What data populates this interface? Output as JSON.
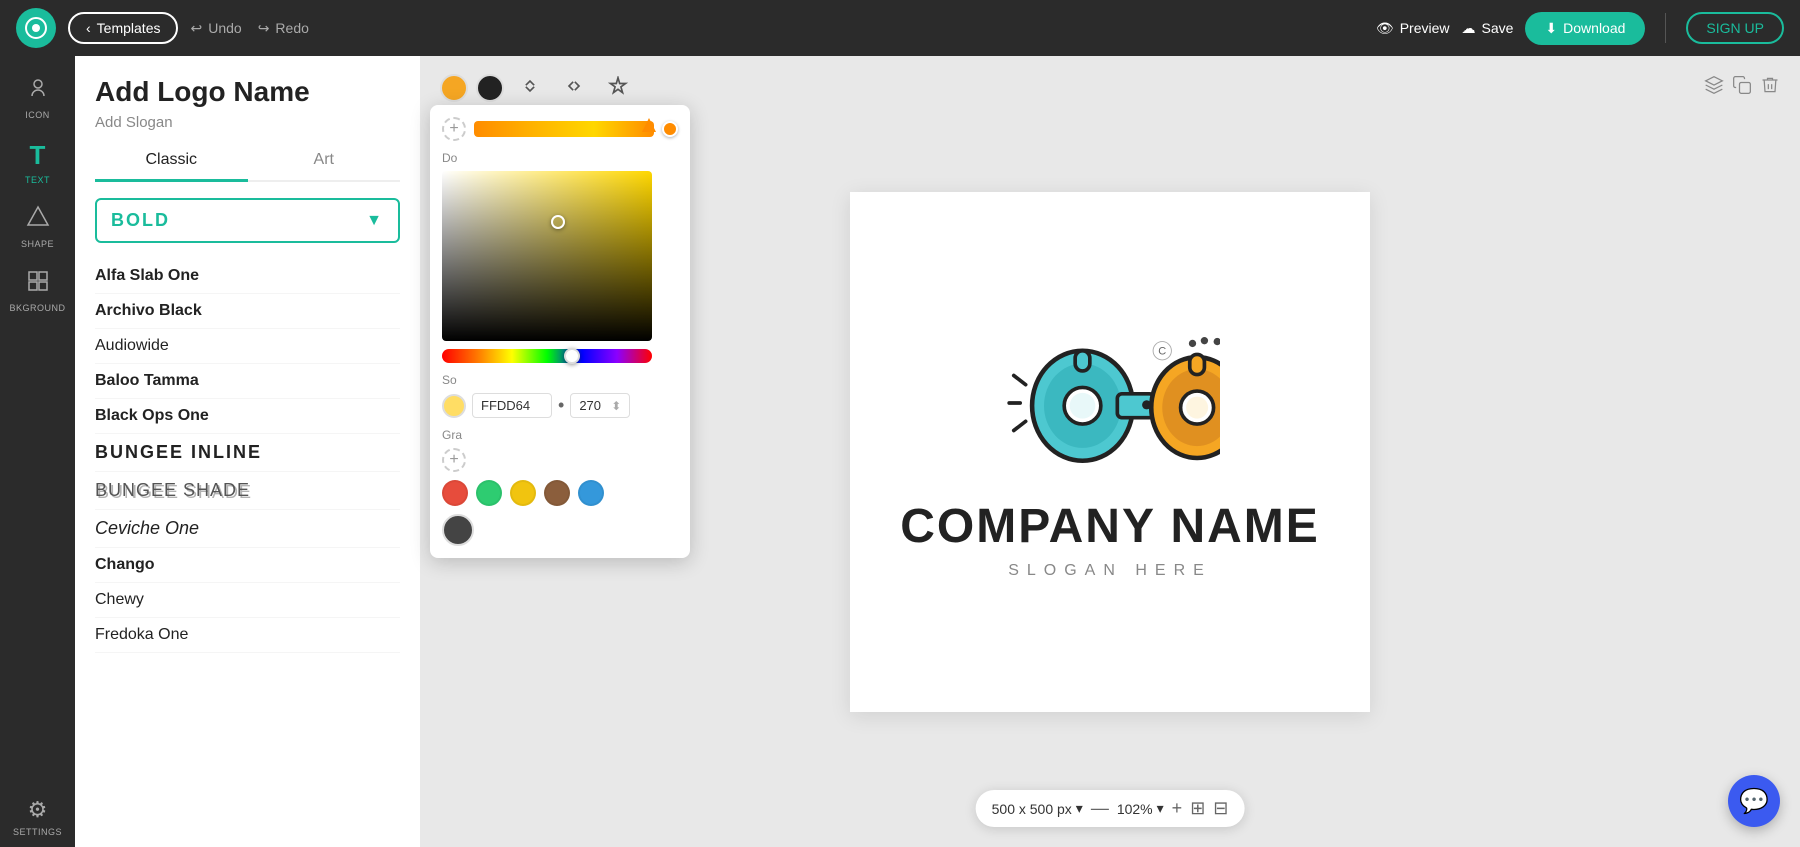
{
  "topbar": {
    "logo_symbol": "◎",
    "templates_label": "Templates",
    "undo_label": "Undo",
    "redo_label": "Redo",
    "preview_label": "Preview",
    "save_label": "Save",
    "download_label": "Download",
    "signup_label": "SIGN UP"
  },
  "sidebar": {
    "items": [
      {
        "id": "icon",
        "label": "ICON",
        "symbol": "⊙",
        "active": false
      },
      {
        "id": "text",
        "label": "TEXT",
        "symbol": "T",
        "active": true
      },
      {
        "id": "shape",
        "label": "SHAPE",
        "symbol": "⬡",
        "active": false
      },
      {
        "id": "bkground",
        "label": "BKGROUND",
        "symbol": "▦",
        "active": false
      },
      {
        "id": "settings",
        "label": "SETTINGS",
        "symbol": "⚙",
        "active": false
      }
    ]
  },
  "panel": {
    "title": "Add Logo Name",
    "subtitle": "Add Slogan",
    "tabs": [
      {
        "id": "classic",
        "label": "Classic",
        "active": true
      },
      {
        "id": "art",
        "label": "Art",
        "active": false
      }
    ],
    "style_dropdown": {
      "value": "BOLD"
    },
    "fonts": [
      {
        "id": "alfa-slab-one",
        "label": "Alfa Slab One",
        "weight": "bold",
        "style": "normal"
      },
      {
        "id": "archivo-black",
        "label": "Archivo Black",
        "weight": "bold",
        "style": "normal"
      },
      {
        "id": "audiowide",
        "label": "Audiowide",
        "weight": "normal",
        "style": "normal"
      },
      {
        "id": "baloo-tamma",
        "label": "Baloo Tamma",
        "weight": "bold",
        "style": "normal"
      },
      {
        "id": "black-ops-one",
        "label": "Black Ops One",
        "weight": "bold",
        "style": "normal"
      },
      {
        "id": "bungee-inline",
        "label": "BUNGEE INLINE",
        "weight": "normal",
        "style": "normal",
        "special": "bungee-inline"
      },
      {
        "id": "bungee-shade",
        "label": "BUNGEE SHADE",
        "weight": "normal",
        "style": "normal",
        "special": "bungee-shade"
      },
      {
        "id": "ceviche-one",
        "label": "Ceviche One",
        "weight": "normal",
        "style": "italic",
        "special": "ceviche"
      },
      {
        "id": "chango",
        "label": "Chango",
        "weight": "bold",
        "style": "normal"
      },
      {
        "id": "chewy",
        "label": "Chewy",
        "weight": "normal",
        "style": "normal"
      },
      {
        "id": "fredoka-one",
        "label": "Fredoka One",
        "weight": "normal",
        "style": "normal"
      }
    ]
  },
  "canvas": {
    "company_name": "COMPANY NAME",
    "slogan": "SLOGAN HERE",
    "size": "500 x 500 px",
    "zoom": "102%"
  },
  "color_picker": {
    "section_do": "Do",
    "section_solid": "So",
    "section_gradient": "Gra",
    "hex_value": "FFDD64",
    "opacity_value": "270",
    "swatches": [
      "#e74c3c",
      "#2ecc71",
      "#f39c12",
      "#8b5e3c",
      "#3498db"
    ],
    "gradient_colors": [
      "#FF6B00",
      "#FFD700",
      "#FF9500"
    ]
  },
  "chat": {
    "symbol": "💬"
  }
}
